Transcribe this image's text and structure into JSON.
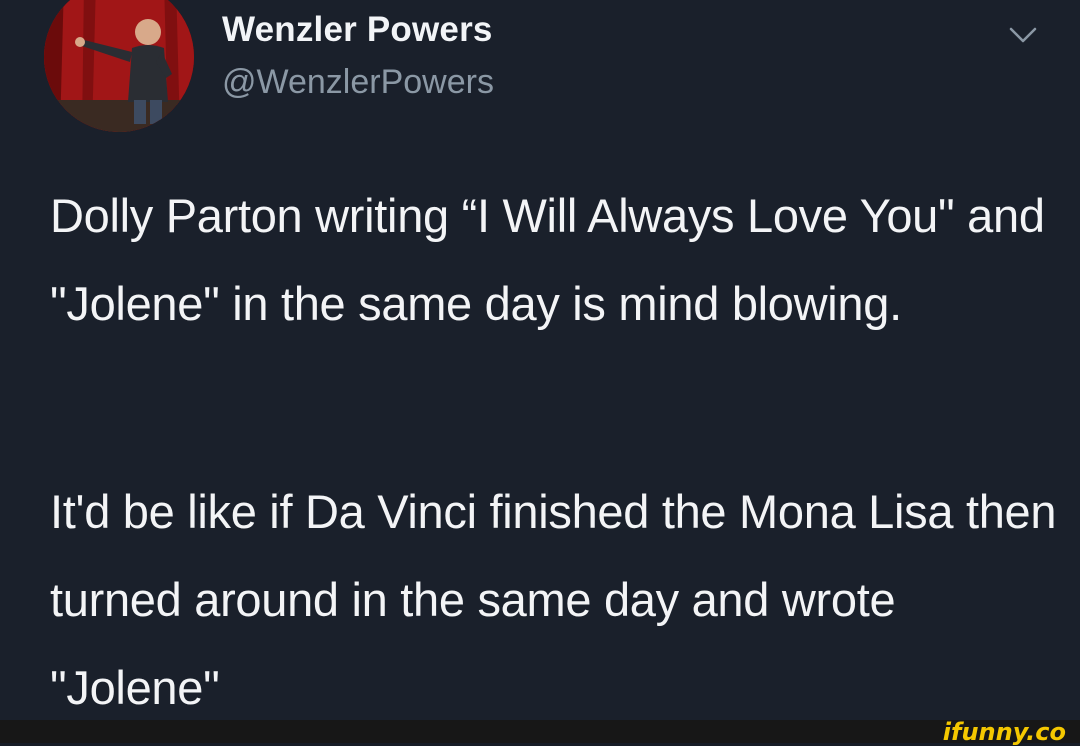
{
  "tweet": {
    "display_name": "Wenzler Powers",
    "handle": "@WenzlerPowers",
    "paragraphs": [
      "Dolly Parton writing “I Will Always Love You\" and \"Jolene\" in the same day is mind blowing.",
      "It'd be like if Da Vinci finished the Mona Lisa then turned around in the same day and wrote \"Jolene\""
    ],
    "menu_icon": "chevron-down-icon"
  },
  "watermark": {
    "text": "ifunny.co",
    "color": "#f5c800"
  },
  "colors": {
    "background": "#1a202b",
    "text": "#f3f4f6",
    "secondary_text": "#8b98a5"
  }
}
